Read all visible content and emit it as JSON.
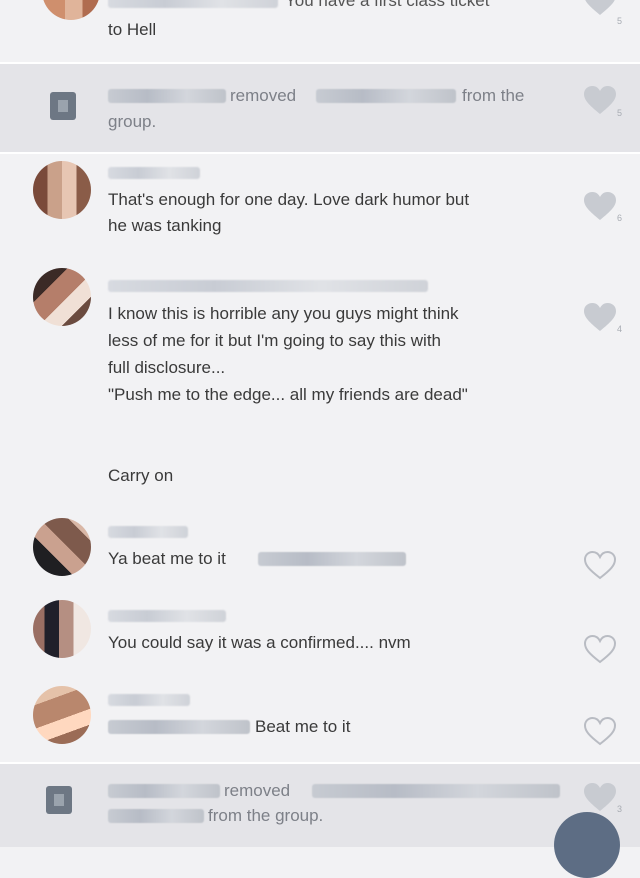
{
  "messages": [
    {
      "id": "m0",
      "type": "comment",
      "text_after": "You have a first class ticket",
      "text_line2": "to Hell",
      "likes": "5",
      "liked": true
    },
    {
      "id": "m1",
      "type": "system",
      "action": "removed",
      "from": "from the",
      "line2": "group.",
      "likes": "5",
      "liked": true
    },
    {
      "id": "m2",
      "type": "comment",
      "text": "That's enough for one day. Love dark humor but\nhe was tanking",
      "likes": "6",
      "liked": true
    },
    {
      "id": "m3",
      "type": "comment",
      "text": "I know this is horrible any you guys might think\nless of me for it but I'm going to say this with\nfull disclosure...\n\"Push me to the edge... all my friends are dead\"\n\n\nCarry on",
      "likes": "4",
      "liked": true
    },
    {
      "id": "m4",
      "type": "comment",
      "text": "Ya beat me to it",
      "liked": false
    },
    {
      "id": "m5",
      "type": "comment",
      "text": "You could say it was a confirmed.... nvm",
      "liked": false
    },
    {
      "id": "m6",
      "type": "comment",
      "text": "Beat me to it",
      "liked": false
    },
    {
      "id": "m7",
      "type": "system",
      "action": "removed",
      "line2": "from the group.",
      "likes": "3",
      "liked": true
    }
  ],
  "colors": {
    "liked_heart": "#c8cbd1",
    "unliked_heart": "#b9bcc3",
    "system_bg": "#e4e4e8",
    "fab": "#5d6d84"
  },
  "icons": {
    "like": "heart-icon",
    "system": "group-icon"
  }
}
